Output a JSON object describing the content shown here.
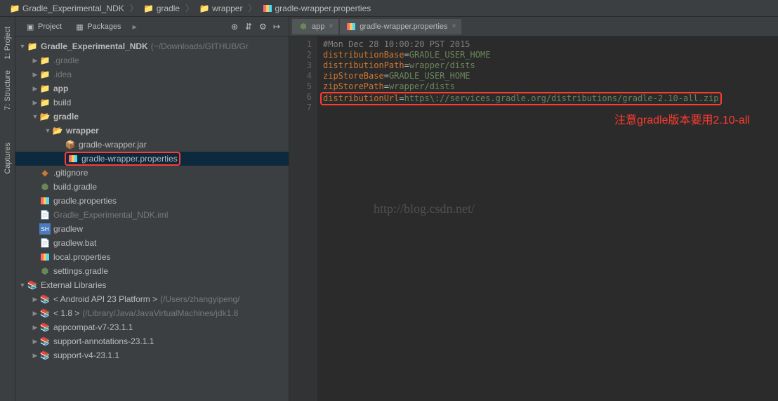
{
  "breadcrumb": [
    {
      "label": "Gradle_Experimental_NDK",
      "icon": "project"
    },
    {
      "label": "gradle",
      "icon": "folder"
    },
    {
      "label": "wrapper",
      "icon": "folder"
    },
    {
      "label": "gradle-wrapper.properties",
      "icon": "props"
    }
  ],
  "gutter_tabs": [
    {
      "label": "1: Project"
    },
    {
      "label": "7: Structure"
    },
    {
      "label": "Captures"
    }
  ],
  "panel": {
    "tabs": [
      {
        "label": "Project"
      },
      {
        "label": "Packages"
      }
    ]
  },
  "tree": {
    "root": {
      "label": "Gradle_Experimental_NDK",
      "path": "(~/Downloads/GITHUB/Gr"
    },
    "nodes": [
      {
        "depth": 1,
        "icon": "folder",
        "label": ".gradle",
        "arrow": "right",
        "dim": true
      },
      {
        "depth": 1,
        "icon": "folder",
        "label": ".idea",
        "arrow": "right",
        "dim": true
      },
      {
        "depth": 1,
        "icon": "folder",
        "label": "app",
        "arrow": "right",
        "bold": true
      },
      {
        "depth": 1,
        "icon": "folder",
        "label": "build",
        "arrow": "right"
      },
      {
        "depth": 1,
        "icon": "folder-open",
        "label": "gradle",
        "arrow": "down",
        "bold": true
      },
      {
        "depth": 2,
        "icon": "folder-open",
        "label": "wrapper",
        "arrow": "down",
        "bold": true
      },
      {
        "depth": 3,
        "icon": "jar",
        "label": "gradle-wrapper.jar",
        "arrow": "none"
      },
      {
        "depth": 3,
        "icon": "props",
        "label": "gradle-wrapper.properties",
        "arrow": "none",
        "selected": true,
        "highlighted": true
      },
      {
        "depth": 1,
        "icon": "git",
        "label": ".gitignore",
        "arrow": "none"
      },
      {
        "depth": 1,
        "icon": "gradle",
        "label": "build.gradle",
        "arrow": "none"
      },
      {
        "depth": 1,
        "icon": "props",
        "label": "gradle.properties",
        "arrow": "none"
      },
      {
        "depth": 1,
        "icon": "file",
        "label": "Gradle_Experimental_NDK.iml",
        "arrow": "none",
        "dim": true
      },
      {
        "depth": 1,
        "icon": "sh",
        "label": "gradlew",
        "arrow": "none"
      },
      {
        "depth": 1,
        "icon": "file",
        "label": "gradlew.bat",
        "arrow": "none"
      },
      {
        "depth": 1,
        "icon": "props",
        "label": "local.properties",
        "arrow": "none"
      },
      {
        "depth": 1,
        "icon": "gradle",
        "label": "settings.gradle",
        "arrow": "none"
      }
    ],
    "ext_label": "External Libraries",
    "ext": [
      {
        "label": "< Android API 23 Platform >",
        "path": "(/Users/zhangyipeng/"
      },
      {
        "label": "< 1.8 >",
        "path": "(/Library/Java/JavaVirtualMachines/jdk1.8"
      },
      {
        "label": "appcompat-v7-23.1.1"
      },
      {
        "label": "support-annotations-23.1.1"
      },
      {
        "label": "support-v4-23.1.1"
      }
    ]
  },
  "editor": {
    "tabs": [
      {
        "label": "app",
        "icon": "gradle"
      },
      {
        "label": "gradle-wrapper.properties",
        "icon": "props",
        "active": true
      }
    ],
    "lines": [
      {
        "n": "1",
        "comment": "#Mon Dec 28 10:00:20 PST 2015"
      },
      {
        "n": "2",
        "key": "distributionBase",
        "val": "GRADLE_USER_HOME"
      },
      {
        "n": "3",
        "key": "distributionPath",
        "val": "wrapper/dists"
      },
      {
        "n": "4",
        "key": "zipStoreBase",
        "val": "GRADLE_USER_HOME"
      },
      {
        "n": "5",
        "key": "zipStorePath",
        "val": "wrapper/dists"
      },
      {
        "n": "6",
        "key": "distributionUrl",
        "val": "https\\://services.gradle.org/distributions/gradle-2.10-all.zip",
        "highlighted": true
      },
      {
        "n": "7"
      }
    ]
  },
  "annotation": "注意gradle版本要用2.10-all",
  "watermark": "http://blog.csdn.net/"
}
